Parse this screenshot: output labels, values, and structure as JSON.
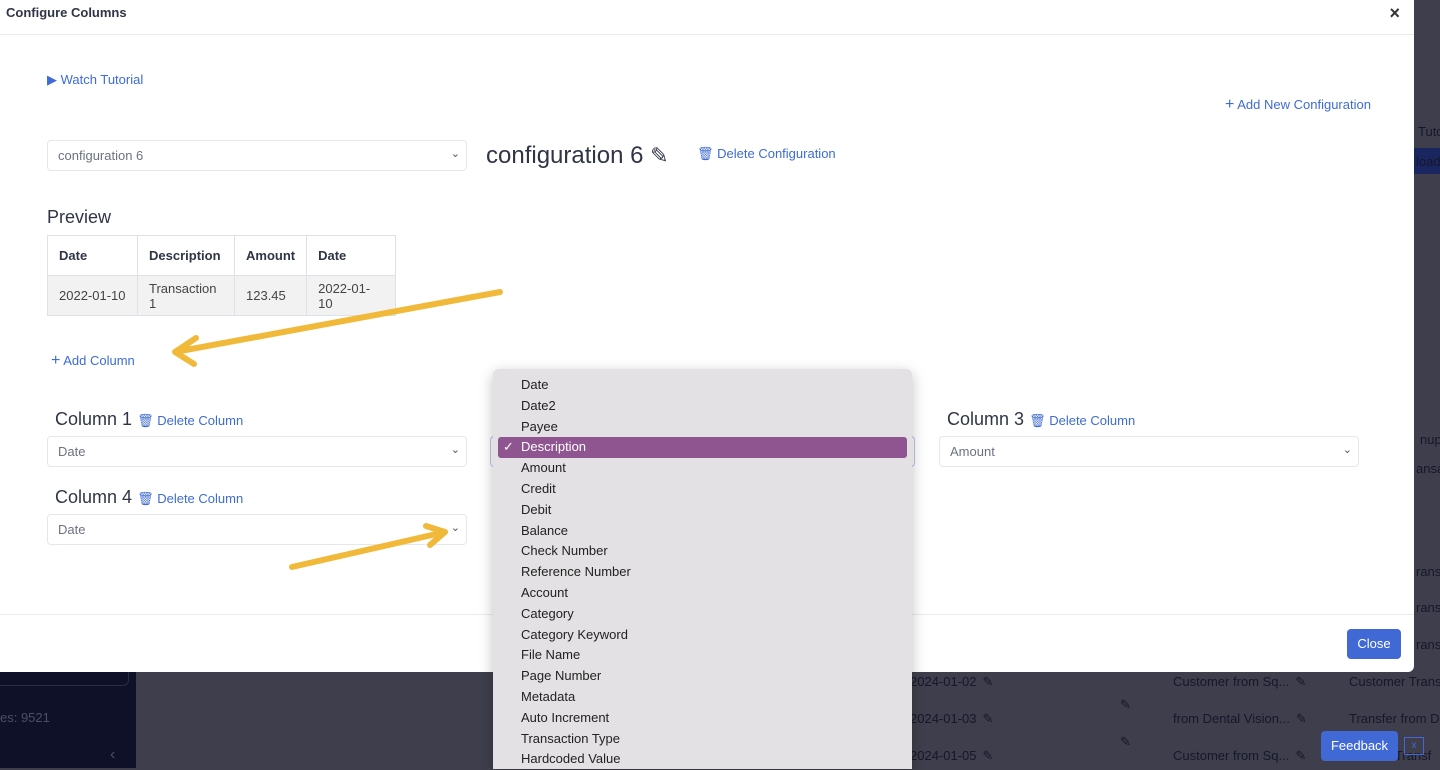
{
  "background": {
    "files_label": "es: 9521",
    "rows": [
      {
        "date": "2024-01-02",
        "desc": "Customer from Sq...",
        "desc2": "Customer Transf"
      },
      {
        "date": "2024-01-03",
        "desc": "from Dental Vision...",
        "desc2": "Transfer from De"
      },
      {
        "date": "2024-01-05",
        "desc": "Customer from Sq...",
        "desc2": "er Transf"
      }
    ],
    "right_fragments": [
      "Tuto",
      "load",
      "nup I",
      "ansa",
      "ransf",
      "ransf",
      "ransf"
    ],
    "feedback_label": "Feedback",
    "feedback_close": "x"
  },
  "modal": {
    "title": "Configure Columns",
    "close_glyph": "×",
    "watch_tutorial": "Watch Tutorial",
    "add_new_configuration": "Add New Configuration",
    "config_select": "configuration 6",
    "config_name": "configuration 6",
    "delete_configuration": "Delete Configuration",
    "preview_title": "Preview",
    "preview_headers": [
      "Date",
      "Description",
      "Amount",
      "Date"
    ],
    "preview_row": [
      "2022-01-10",
      "Transaction 1",
      "123.45",
      "2022-01-10"
    ],
    "add_column": "Add Column",
    "columns": [
      {
        "label": "Column 1",
        "delete": "Delete Column",
        "value": "Date"
      },
      {
        "label": "Column 3",
        "delete": "Delete Column",
        "value": "Amount"
      },
      {
        "label": "Column 4",
        "delete": "Delete Column",
        "value": "Date"
      }
    ],
    "close_button": "Close"
  },
  "dropdown": {
    "selected": "Description",
    "options": [
      "Date",
      "Date2",
      "Payee",
      "Description",
      "Amount",
      "Credit",
      "Debit",
      "Balance",
      "Check Number",
      "Reference Number",
      "Account",
      "Category",
      "Category Keyword",
      "File Name",
      "Page Number",
      "Metadata",
      "Auto Increment",
      "Transaction Type",
      "Hardcoded Value"
    ]
  },
  "colors": {
    "accent": "#3e6bd6",
    "button": "#4169d6",
    "highlight": "#8e5590",
    "annotation_arrow": "#f0b93a"
  }
}
